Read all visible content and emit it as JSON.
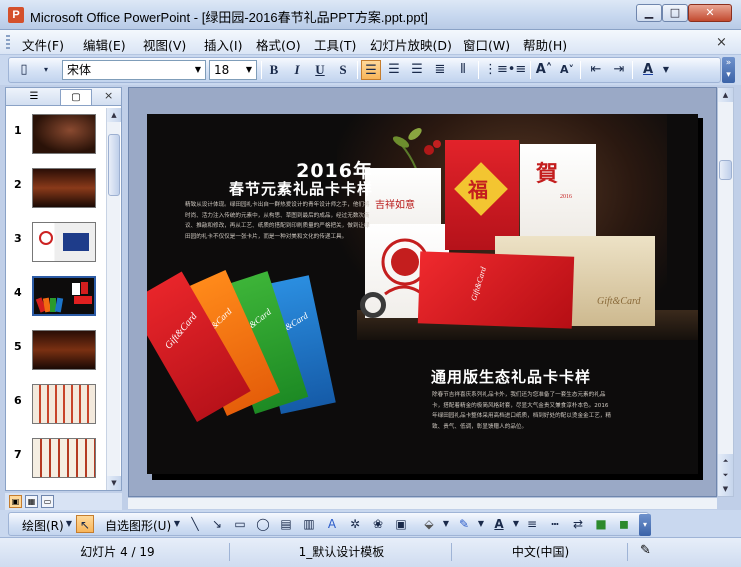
{
  "window": {
    "title": "Microsoft Office PowerPoint - [绿田园-2016春节礼品PPT方案.ppt.ppt]",
    "app_icon_letter": "P"
  },
  "menu": {
    "items": [
      "文件(F)",
      "编辑(E)",
      "视图(V)",
      "插入(I)",
      "格式(O)",
      "工具(T)",
      "幻灯片放映(D)",
      "窗口(W)",
      "帮助(H)"
    ],
    "close_glyph": "×"
  },
  "format_toolbar": {
    "font_name": "宋体",
    "font_size": "18",
    "bold": "B",
    "italic": "I",
    "underline": "U",
    "shadow": "S"
  },
  "slide_pane": {
    "close_glyph": "×",
    "slide_numbers": [
      "1",
      "2",
      "3",
      "4",
      "5",
      "6",
      "7"
    ],
    "selected_slide": "4"
  },
  "slide": {
    "heading_year": "2016年",
    "heading_main": "春节元素礼品卡卡样",
    "paragraph1": "精致从设计体现。绿田园礼卡出自一群热爱设计的青年设计师之手，他们将时尚、活力注入传统的元素中，从构思、草图到最后的成品，经过无数次商议、推敲和修改，再从工艺、纸质的搭配到印刷质量的严格把关，做到让绿田园的礼卡不仅仅是一张卡片，而是一种对美和文化的传递工具。",
    "heading_general": "通用版生态礼品卡卡样",
    "paragraph2": "除春节吉祥喜庆系列礼品卡外，我们还为您准备了一套生态元素的礼品卡，搭配着精金的极简风格封套，尽显大气金贵又兼食淳朴本色。2016年绿田园礼品卡整体采用高档进口纸质，档到好处的配以烫金金工艺，精致、贵气、低调，彰显馈赠人的品位。",
    "card_brand": "Gift&Card",
    "card_fu": "福",
    "card_he": "賀",
    "card_jixiang": "吉祥如意",
    "card_year": "2016"
  },
  "draw_toolbar": {
    "draw_label": "绘图(R)",
    "autoshape_label": "自选图形(U)"
  },
  "status": {
    "slide_info": "幻灯片 4 / 19",
    "template": "1_默认设计模板",
    "language": "中文(中国)"
  },
  "colors": {
    "accent_selected": "#f8b55a",
    "titlebar": "#c5d6ee",
    "slide_background": "#0d0c0c"
  }
}
